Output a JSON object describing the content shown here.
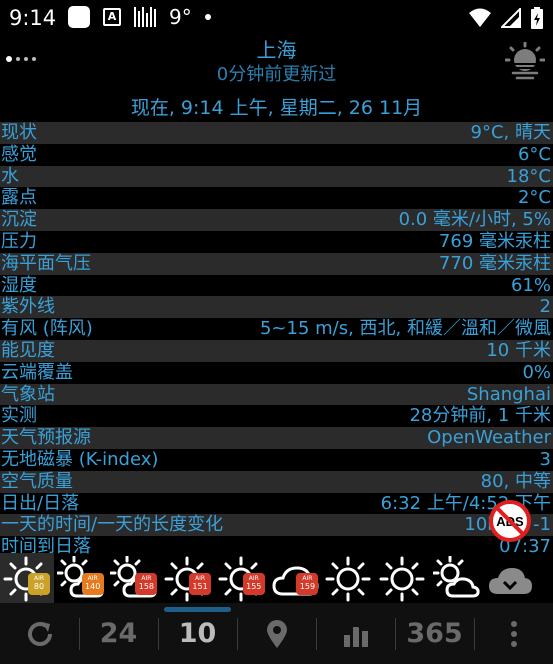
{
  "status_bar": {
    "time": "9:14",
    "temp": "9°",
    "icons": [
      "app-square-icon",
      "a-box-icon",
      "barcode-icon",
      "dot-icon",
      "wifi-icon",
      "signal-icon",
      "battery-icon"
    ]
  },
  "header": {
    "city": "上海",
    "updated": "0分钟前更新过",
    "now": "现在, 9:14 上午, 星期二, 26 11月",
    "icon": "fog-sun-icon"
  },
  "rows": [
    {
      "label": "现状",
      "value": "9°C, 晴天"
    },
    {
      "label": "感觉",
      "value": "6°C"
    },
    {
      "label": "水",
      "value": "18°C"
    },
    {
      "label": "露点",
      "value": "2°C"
    },
    {
      "label": "沉淀",
      "value": "0.0 毫米/小时, 5%"
    },
    {
      "label": "压力",
      "value": "769 毫米汞柱"
    },
    {
      "label": "海平面气压",
      "value": "770 毫米汞柱"
    },
    {
      "label": "湿度",
      "value": "61%"
    },
    {
      "label": "紫外线",
      "value": "2"
    },
    {
      "label": "有风 (阵风)",
      "value": "5~15 m/s, 西北, 和緩／溫和／微風"
    },
    {
      "label": "能见度",
      "value": "10 千米"
    },
    {
      "label": "云端覆盖",
      "value": "0%"
    },
    {
      "label": "气象站",
      "value": "Shanghai"
    },
    {
      "label": "实测",
      "value": "28分钟前, 1 千米"
    },
    {
      "label": "天气预报源",
      "value": "OpenWeather"
    },
    {
      "label": "无地磁暴 (K-index)",
      "value": "3"
    },
    {
      "label": "空气质量",
      "value": "80, 中等"
    },
    {
      "label": "日出/日落",
      "value": "6:32 上午/4:52 下午"
    },
    {
      "label": "一天的时间/一天的长度变化",
      "value": "10h20, -1"
    },
    {
      "label": "时间到日落",
      "value": "07:37"
    }
  ],
  "forecast": [
    {
      "icon": "sun-icon",
      "air": "80",
      "air_color": "#c9a227"
    },
    {
      "icon": "sun-cloud-icon",
      "air": "140",
      "air_color": "#e87a1e"
    },
    {
      "icon": "sun-cloud-icon",
      "air": "158",
      "air_color": "#d43a2a"
    },
    {
      "icon": "sun-icon",
      "air": "151",
      "air_color": "#d43a2a"
    },
    {
      "icon": "sun-icon",
      "air": "155",
      "air_color": "#d43a2a"
    },
    {
      "icon": "cloud-icon",
      "air": "159",
      "air_color": "#d43a2a"
    },
    {
      "icon": "sun-icon",
      "air": "",
      "air_color": ""
    },
    {
      "icon": "sun-icon",
      "air": "",
      "air_color": ""
    },
    {
      "icon": "sun-cloud-icon",
      "air": "",
      "air_color": ""
    },
    {
      "icon": "cloud-download-icon",
      "air": "",
      "air_color": ""
    }
  ],
  "air_label": "AIR",
  "ads_label": "ADS",
  "bottom_bar": {
    "refresh_icon": "refresh-icon",
    "tab_24": "24",
    "tab_10": "10",
    "map_icon": "map-pin-icon",
    "chart_icon": "chart-icon",
    "tab_365": "365",
    "menu_icon": "more-vertical-icon"
  },
  "colors": {
    "text": "#3aa0d8",
    "row_stripe": "#2b2b2b",
    "background": "#000000"
  }
}
